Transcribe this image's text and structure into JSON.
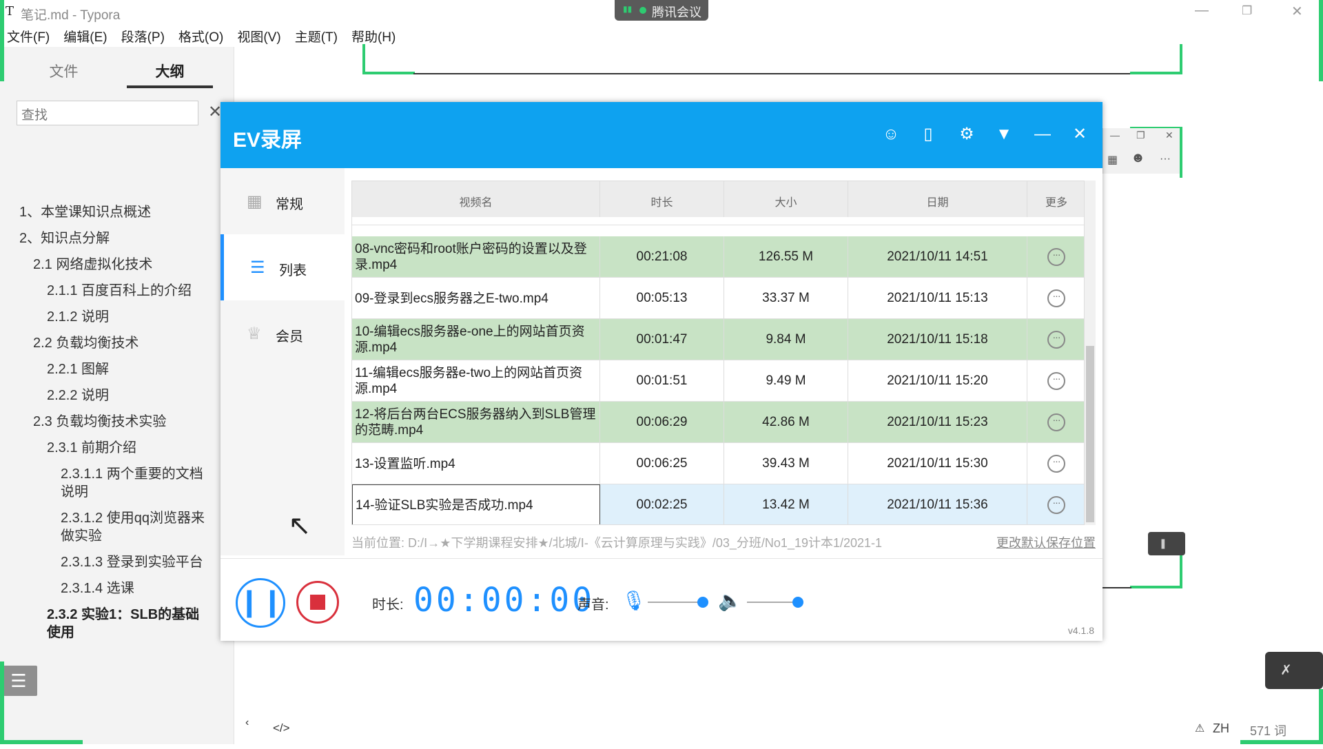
{
  "typora": {
    "app_icon": "T",
    "title": "笔记.md - Typora",
    "menus": [
      "文件(F)",
      "编辑(E)",
      "段落(P)",
      "格式(O)",
      "视图(V)",
      "主题(T)",
      "帮助(H)"
    ],
    "tabs": [
      "文件",
      "大纲"
    ],
    "search_placeholder": "查找",
    "outline": [
      {
        "text": "1、本堂课知识点概述"
      },
      {
        "text": "2、知识点分解"
      },
      {
        "text": "2.1 网络虚拟化技术"
      },
      {
        "text": "2.1.1 百度百科上的介绍"
      },
      {
        "text": "2.1.2 说明"
      },
      {
        "text": "2.2 负载均衡技术"
      },
      {
        "text": "2.2.1 图解"
      },
      {
        "text": "2.2.2 说明"
      },
      {
        "text": "2.3 负载均衡技术实验"
      },
      {
        "text": "2.3.1 前期介绍"
      },
      {
        "text": "2.3.1.1 两个重要的文档说明"
      },
      {
        "text": "2.3.1.2 使用qq浏览器来做实验"
      },
      {
        "text": "2.3.1.3 登录到实验平台"
      },
      {
        "text": "2.3.1.4 选课"
      },
      {
        "text": "2.3.2 实验1：SLB的基础使用"
      }
    ],
    "status": {
      "lang": "ZH",
      "word_count": "571 词",
      "warning_icon": "warning-icon"
    }
  },
  "tencent_meeting": {
    "label": "腾讯会议"
  },
  "ev": {
    "logo": "EV录屏",
    "nav": [
      {
        "label": "常规",
        "icon": "grid-icon"
      },
      {
        "label": "列表",
        "icon": "list-icon"
      },
      {
        "label": "会员",
        "icon": "crown-icon"
      }
    ],
    "columns": [
      "视频名",
      "时长",
      "大小",
      "日期",
      "更多"
    ],
    "rows": [
      {
        "name": "08-vnc密码和root账户密码的设置以及登录.mp4",
        "duration": "00:21:08",
        "size": "126.55 M",
        "date": "2021/10/11 14:51",
        "style": "green"
      },
      {
        "name": "09-登录到ecs服务器之E-two.mp4",
        "duration": "00:05:13",
        "size": "33.37 M",
        "date": "2021/10/11 15:13",
        "style": "white"
      },
      {
        "name": "10-编辑ecs服务器e-one上的网站首页资源.mp4",
        "duration": "00:01:47",
        "size": "9.84 M",
        "date": "2021/10/11 15:18",
        "style": "green"
      },
      {
        "name": "11-编辑ecs服务器e-two上的网站首页资源.mp4",
        "duration": "00:01:51",
        "size": "9.49 M",
        "date": "2021/10/11 15:20",
        "style": "white"
      },
      {
        "name": "12-将后台两台ECS服务器纳入到SLB管理的范畴.mp4",
        "duration": "00:06:29",
        "size": "42.86 M",
        "date": "2021/10/11 15:23",
        "style": "green"
      },
      {
        "name": "13-设置监听.mp4",
        "duration": "00:06:25",
        "size": "39.43 M",
        "date": "2021/10/11 15:30",
        "style": "white"
      },
      {
        "name": "14-验证SLB实验是否成功.mp4",
        "duration": "00:02:25",
        "size": "13.42 M",
        "date": "2021/10/11 15:36",
        "style": "selected"
      }
    ],
    "path_label": "当前位置: D:/Ⅰ→★下学期课程安排★/北城/Ⅰ-《云计算原理与实践》/03_分班/No1_19计本1/2021-1",
    "path_link": "更改默认保存位置",
    "duration_label": "时长:",
    "duration_value": "00:00:00",
    "sound_label": "声音:",
    "version": "v4.1.8",
    "colors": {
      "header": "#0ea2f0",
      "accent": "#1e90ff",
      "stop": "#d9303c",
      "row_green": "#c8e3c5"
    }
  }
}
